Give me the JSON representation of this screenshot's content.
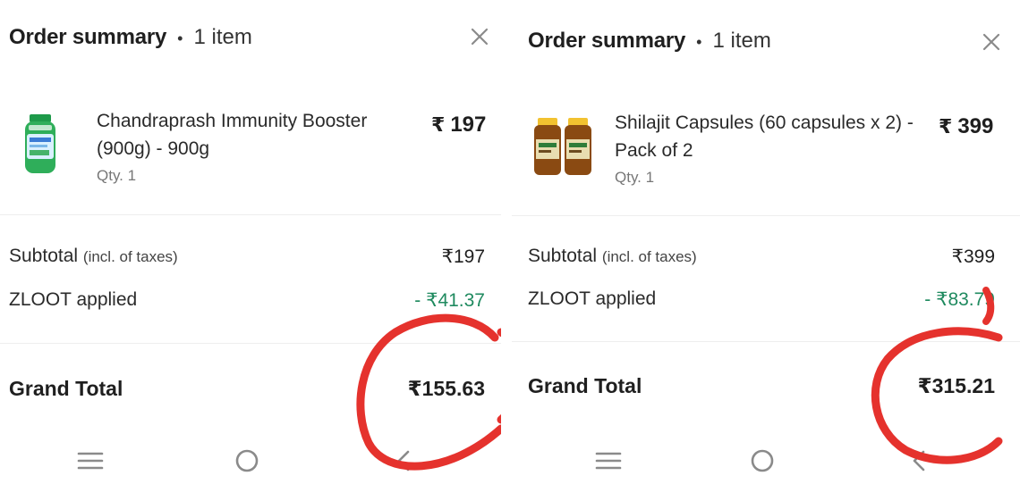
{
  "panels": [
    {
      "header": {
        "title": "Order summary",
        "separator": "•",
        "item_count": "1 item"
      },
      "item": {
        "name": "Chandraprash Immunity Booster (900g) - 900g",
        "qty": "Qty. 1",
        "price_symbol": "₹",
        "price": "197"
      },
      "subtotal": {
        "label": "Subtotal",
        "note": "(incl. of taxes)",
        "value": "₹197"
      },
      "zloot": {
        "label": "ZLOOT applied",
        "value": "- ₹41.37"
      },
      "grand_total": {
        "label": "Grand Total",
        "value": "₹155.63"
      }
    },
    {
      "header": {
        "title": "Order summary",
        "separator": "•",
        "item_count": "1 item"
      },
      "item": {
        "name": "Shilajit Capsules (60 capsules x 2) - Pack of 2",
        "qty": "Qty. 1",
        "price_symbol": "₹",
        "price": "399"
      },
      "subtotal": {
        "label": "Subtotal",
        "note": "(incl. of taxes)",
        "value": "₹399"
      },
      "zloot": {
        "label": "ZLOOT applied",
        "value": "- ₹83.79"
      },
      "grand_total": {
        "label": "Grand Total",
        "value": "₹315.21"
      }
    }
  ],
  "icons": {
    "close": "close-icon",
    "menu": "menu-icon",
    "home": "home-circle-icon",
    "back": "back-chevron-icon"
  },
  "colors": {
    "discount_green": "#1f8a5f",
    "annotation_red": "#e5322d",
    "divider": "#eeeeee"
  }
}
